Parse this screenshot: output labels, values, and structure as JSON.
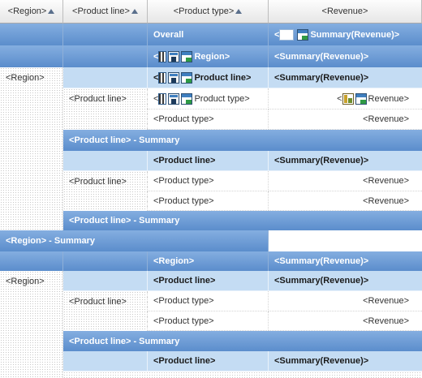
{
  "header": {
    "region": "<Region>",
    "product_line": "<Product line>",
    "product_type": "<Product type>",
    "revenue": "<Revenue>"
  },
  "labels": {
    "overall": "Overall",
    "lt": "<",
    "region": "<Region>",
    "region_plain": "Region>",
    "product_line": "<Product line>",
    "product_line_plain": "Product line>",
    "product_type": "<Product type>",
    "product_type_plain": "Product type>",
    "revenue": "<Revenue>",
    "revenue_plain": "Revenue>",
    "summary_revenue": "<Summary(Revenue)>",
    "summary_revenue_plain": "Summary(Revenue)>",
    "product_line_summary": "<Product line>  -  Summary",
    "region_summary": "<Region>  -  Summary"
  },
  "icons": [
    "sort-icon",
    "filter-icon",
    "total-icon",
    "selection-icon",
    "summary-icon"
  ],
  "colors": {
    "header_bar": "#5b8dcc",
    "light_row": "#c4dcf3",
    "header_cell": "#e6e6e6",
    "corner_marker": "#e0a030"
  }
}
